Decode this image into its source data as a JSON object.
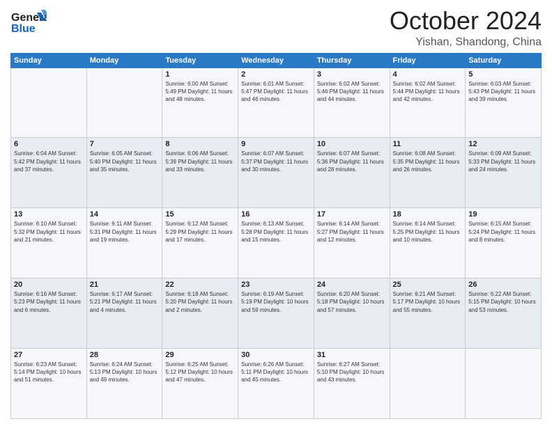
{
  "logo": {
    "line1": "General",
    "line2": "Blue"
  },
  "title": "October 2024",
  "location": "Yishan, Shandong, China",
  "days_of_week": [
    "Sunday",
    "Monday",
    "Tuesday",
    "Wednesday",
    "Thursday",
    "Friday",
    "Saturday"
  ],
  "weeks": [
    [
      {
        "day": "",
        "info": ""
      },
      {
        "day": "",
        "info": ""
      },
      {
        "day": "1",
        "info": "Sunrise: 6:00 AM\nSunset: 5:49 PM\nDaylight: 11 hours and 48 minutes."
      },
      {
        "day": "2",
        "info": "Sunrise: 6:01 AM\nSunset: 5:47 PM\nDaylight: 11 hours and 46 minutes."
      },
      {
        "day": "3",
        "info": "Sunrise: 6:02 AM\nSunset: 5:46 PM\nDaylight: 11 hours and 44 minutes."
      },
      {
        "day": "4",
        "info": "Sunrise: 6:02 AM\nSunset: 5:44 PM\nDaylight: 11 hours and 42 minutes."
      },
      {
        "day": "5",
        "info": "Sunrise: 6:03 AM\nSunset: 5:43 PM\nDaylight: 11 hours and 39 minutes."
      }
    ],
    [
      {
        "day": "6",
        "info": "Sunrise: 6:04 AM\nSunset: 5:42 PM\nDaylight: 11 hours and 37 minutes."
      },
      {
        "day": "7",
        "info": "Sunrise: 6:05 AM\nSunset: 5:40 PM\nDaylight: 11 hours and 35 minutes."
      },
      {
        "day": "8",
        "info": "Sunrise: 6:06 AM\nSunset: 5:39 PM\nDaylight: 11 hours and 33 minutes."
      },
      {
        "day": "9",
        "info": "Sunrise: 6:07 AM\nSunset: 5:37 PM\nDaylight: 11 hours and 30 minutes."
      },
      {
        "day": "10",
        "info": "Sunrise: 6:07 AM\nSunset: 5:36 PM\nDaylight: 11 hours and 28 minutes."
      },
      {
        "day": "11",
        "info": "Sunrise: 6:08 AM\nSunset: 5:35 PM\nDaylight: 11 hours and 26 minutes."
      },
      {
        "day": "12",
        "info": "Sunrise: 6:09 AM\nSunset: 5:33 PM\nDaylight: 11 hours and 24 minutes."
      }
    ],
    [
      {
        "day": "13",
        "info": "Sunrise: 6:10 AM\nSunset: 5:32 PM\nDaylight: 11 hours and 21 minutes."
      },
      {
        "day": "14",
        "info": "Sunrise: 6:11 AM\nSunset: 5:31 PM\nDaylight: 11 hours and 19 minutes."
      },
      {
        "day": "15",
        "info": "Sunrise: 6:12 AM\nSunset: 5:29 PM\nDaylight: 11 hours and 17 minutes."
      },
      {
        "day": "16",
        "info": "Sunrise: 6:13 AM\nSunset: 5:28 PM\nDaylight: 11 hours and 15 minutes."
      },
      {
        "day": "17",
        "info": "Sunrise: 6:14 AM\nSunset: 5:27 PM\nDaylight: 11 hours and 12 minutes."
      },
      {
        "day": "18",
        "info": "Sunrise: 6:14 AM\nSunset: 5:25 PM\nDaylight: 11 hours and 10 minutes."
      },
      {
        "day": "19",
        "info": "Sunrise: 6:15 AM\nSunset: 5:24 PM\nDaylight: 11 hours and 8 minutes."
      }
    ],
    [
      {
        "day": "20",
        "info": "Sunrise: 6:16 AM\nSunset: 5:23 PM\nDaylight: 11 hours and 6 minutes."
      },
      {
        "day": "21",
        "info": "Sunrise: 6:17 AM\nSunset: 5:21 PM\nDaylight: 11 hours and 4 minutes."
      },
      {
        "day": "22",
        "info": "Sunrise: 6:18 AM\nSunset: 5:20 PM\nDaylight: 11 hours and 2 minutes."
      },
      {
        "day": "23",
        "info": "Sunrise: 6:19 AM\nSunset: 5:19 PM\nDaylight: 10 hours and 59 minutes."
      },
      {
        "day": "24",
        "info": "Sunrise: 6:20 AM\nSunset: 5:18 PM\nDaylight: 10 hours and 57 minutes."
      },
      {
        "day": "25",
        "info": "Sunrise: 6:21 AM\nSunset: 5:17 PM\nDaylight: 10 hours and 55 minutes."
      },
      {
        "day": "26",
        "info": "Sunrise: 6:22 AM\nSunset: 5:15 PM\nDaylight: 10 hours and 53 minutes."
      }
    ],
    [
      {
        "day": "27",
        "info": "Sunrise: 6:23 AM\nSunset: 5:14 PM\nDaylight: 10 hours and 51 minutes."
      },
      {
        "day": "28",
        "info": "Sunrise: 6:24 AM\nSunset: 5:13 PM\nDaylight: 10 hours and 49 minutes."
      },
      {
        "day": "29",
        "info": "Sunrise: 6:25 AM\nSunset: 5:12 PM\nDaylight: 10 hours and 47 minutes."
      },
      {
        "day": "30",
        "info": "Sunrise: 6:26 AM\nSunset: 5:11 PM\nDaylight: 10 hours and 45 minutes."
      },
      {
        "day": "31",
        "info": "Sunrise: 6:27 AM\nSunset: 5:10 PM\nDaylight: 10 hours and 43 minutes."
      },
      {
        "day": "",
        "info": ""
      },
      {
        "day": "",
        "info": ""
      }
    ]
  ]
}
